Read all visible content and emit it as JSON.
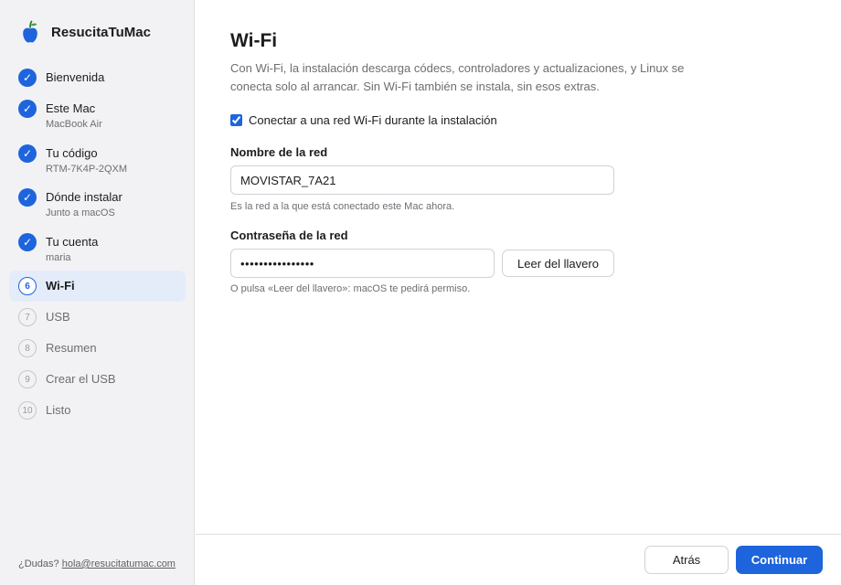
{
  "app": {
    "name": "ResucitaTuMac",
    "logo_icon": "apple-icon"
  },
  "colors": {
    "accent": "#1e64dc",
    "sidebar_bg": "#f2f2f4",
    "active_bg": "#e4ecfa"
  },
  "sidebar": {
    "steps": [
      {
        "marker": "✓",
        "label": "Bienvenida",
        "sub": "",
        "state": "done"
      },
      {
        "marker": "✓",
        "label": "Este Mac",
        "sub": "MacBook Air",
        "state": "done"
      },
      {
        "marker": "✓",
        "label": "Tu código",
        "sub": "RTM-7K4P-2QXM",
        "state": "done"
      },
      {
        "marker": "✓",
        "label": "Dónde instalar",
        "sub": "Junto a macOS",
        "state": "done"
      },
      {
        "marker": "✓",
        "label": "Tu cuenta",
        "sub": "maria",
        "state": "done"
      },
      {
        "marker": "6",
        "label": "Wi-Fi",
        "sub": "",
        "state": "active"
      },
      {
        "marker": "7",
        "label": "USB",
        "sub": "",
        "state": "pending"
      },
      {
        "marker": "8",
        "label": "Resumen",
        "sub": "",
        "state": "pending"
      },
      {
        "marker": "9",
        "label": "Crear el USB",
        "sub": "",
        "state": "pending"
      },
      {
        "marker": "10",
        "label": "Listo",
        "sub": "",
        "state": "pending"
      }
    ],
    "help": {
      "prefix": "¿Dudas?",
      "email": "hola@resucitatumac.com"
    }
  },
  "main": {
    "title": "Wi-Fi",
    "description": "Con Wi-Fi, la instalación descarga códecs, controladores y actualizaciones, y Linux se conecta solo al arrancar. Sin Wi-Fi también se instala, sin esos extras.",
    "connect_checkbox": {
      "label": "Conectar a una red Wi-Fi durante la instalación",
      "checked": true
    },
    "network": {
      "label": "Nombre de la red",
      "value": "MOVISTAR_7A21",
      "hint": "Es la red a la que está conectado este Mac ahora."
    },
    "password": {
      "label": "Contraseña de la red",
      "value": "••••••••••••••••",
      "keychain_button": "Leer del llavero",
      "hint": "O pulsa «Leer del llavero»: macOS te pedirá permiso."
    }
  },
  "footer": {
    "back_label": "Atrás",
    "continue_label": "Continuar"
  }
}
